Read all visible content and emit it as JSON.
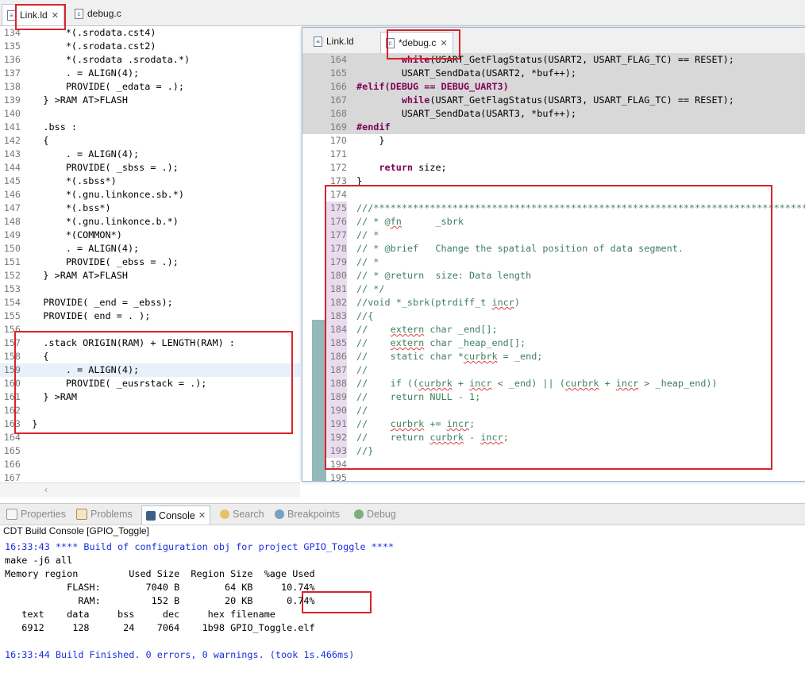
{
  "main_editor": {
    "tabs": [
      {
        "label": "Link.ld",
        "icon": "linker-file-icon",
        "active": true
      },
      {
        "label": "debug.c",
        "icon": "c-file-icon",
        "active": false
      }
    ],
    "lines": [
      {
        "n": "134",
        "t": "      *(.srodata.cst4)"
      },
      {
        "n": "135",
        "t": "      *(.srodata.cst2)"
      },
      {
        "n": "136",
        "t": "      *(.srodata .srodata.*)"
      },
      {
        "n": "137",
        "t": "      . = ALIGN(4);"
      },
      {
        "n": "138",
        "t": "      PROVIDE( _edata = .);"
      },
      {
        "n": "139",
        "t": "  } >RAM AT>FLASH"
      },
      {
        "n": "140",
        "t": ""
      },
      {
        "n": "141",
        "t": "  .bss :"
      },
      {
        "n": "142",
        "t": "  {"
      },
      {
        "n": "143",
        "t": "      . = ALIGN(4);"
      },
      {
        "n": "144",
        "t": "      PROVIDE( _sbss = .);"
      },
      {
        "n": "145",
        "t": "      *(.sbss*)"
      },
      {
        "n": "146",
        "t": "      *(.gnu.linkonce.sb.*)"
      },
      {
        "n": "147",
        "t": "      *(.bss*)"
      },
      {
        "n": "148",
        "t": "      *(.gnu.linkonce.b.*)"
      },
      {
        "n": "149",
        "t": "      *(COMMON*)"
      },
      {
        "n": "150",
        "t": "      . = ALIGN(4);"
      },
      {
        "n": "151",
        "t": "      PROVIDE( _ebss = .);"
      },
      {
        "n": "152",
        "t": "  } >RAM AT>FLASH"
      },
      {
        "n": "153",
        "t": ""
      },
      {
        "n": "154",
        "t": "  PROVIDE( _end = _ebss);"
      },
      {
        "n": "155",
        "t": "  PROVIDE( end = . );"
      },
      {
        "n": "156",
        "t": ""
      },
      {
        "n": "157",
        "t": "  .stack ORIGIN(RAM) + LENGTH(RAM) :"
      },
      {
        "n": "158",
        "t": "  {"
      },
      {
        "n": "159",
        "t": "      . = ALIGN(4);"
      },
      {
        "n": "160",
        "t": "      PROVIDE( _eusrstack = .);"
      },
      {
        "n": "161",
        "t": "  } >RAM"
      },
      {
        "n": "162",
        "t": ""
      },
      {
        "n": "163",
        "t": "}"
      },
      {
        "n": "164",
        "t": ""
      },
      {
        "n": "165",
        "t": ""
      },
      {
        "n": "166",
        "t": ""
      },
      {
        "n": "167",
        "t": ""
      }
    ]
  },
  "overlay_editor": {
    "tabs": [
      {
        "label": "Link.ld",
        "icon": "linker-file-icon",
        "active": false
      },
      {
        "label": "*debug.c",
        "icon": "c-file-icon",
        "active": true
      }
    ],
    "lines": [
      {
        "n": "164",
        "t": "        while(USART_GetFlagStatus(USART2, USART_FLAG_TC) == RESET);",
        "kind": "gray"
      },
      {
        "n": "165",
        "t": "        USART_SendData(USART2, *buf++);",
        "kind": "gray"
      },
      {
        "n": "166",
        "t": "#elif(DEBUG == DEBUG_UART3)",
        "kind": "gray"
      },
      {
        "n": "167",
        "t": "        while(USART_GetFlagStatus(USART3, USART_FLAG_TC) == RESET);",
        "kind": "gray"
      },
      {
        "n": "168",
        "t": "        USART_SendData(USART3, *buf++);",
        "kind": "gray"
      },
      {
        "n": "169",
        "t": "#endif",
        "kind": "gray"
      },
      {
        "n": "170",
        "t": "    }",
        "kind": "code"
      },
      {
        "n": "171",
        "t": "",
        "kind": "code"
      },
      {
        "n": "172",
        "t": "    return size;",
        "kind": "code"
      },
      {
        "n": "173",
        "t": "}",
        "kind": "code"
      },
      {
        "n": "174",
        "t": "",
        "kind": "code"
      },
      {
        "n": "175",
        "t": "///*****************************************************************************",
        "kind": "comment"
      },
      {
        "n": "176",
        "t": "// * @fn      _sbrk",
        "kind": "comment"
      },
      {
        "n": "177",
        "t": "// *",
        "kind": "comment"
      },
      {
        "n": "178",
        "t": "// * @brief   Change the spatial position of data segment.",
        "kind": "comment"
      },
      {
        "n": "179",
        "t": "// *",
        "kind": "comment"
      },
      {
        "n": "180",
        "t": "// * @return  size: Data length",
        "kind": "comment"
      },
      {
        "n": "181",
        "t": "// */",
        "kind": "comment"
      },
      {
        "n": "182",
        "t": "//void *_sbrk(ptrdiff_t incr)",
        "kind": "comment"
      },
      {
        "n": "183",
        "t": "//{",
        "kind": "comment"
      },
      {
        "n": "184",
        "t": "//    extern char _end[];",
        "kind": "comment"
      },
      {
        "n": "185",
        "t": "//    extern char _heap_end[];",
        "kind": "comment"
      },
      {
        "n": "186",
        "t": "//    static char *curbrk = _end;",
        "kind": "comment"
      },
      {
        "n": "187",
        "t": "//",
        "kind": "comment"
      },
      {
        "n": "188",
        "t": "//    if ((curbrk + incr < _end) || (curbrk + incr > _heap_end))",
        "kind": "comment"
      },
      {
        "n": "189",
        "t": "//    return NULL - 1;",
        "kind": "comment"
      },
      {
        "n": "190",
        "t": "//",
        "kind": "comment"
      },
      {
        "n": "191",
        "t": "//    curbrk += incr;",
        "kind": "comment"
      },
      {
        "n": "192",
        "t": "//    return curbrk - incr;",
        "kind": "comment"
      },
      {
        "n": "193",
        "t": "//}",
        "kind": "comment"
      },
      {
        "n": "194",
        "t": "",
        "kind": "code"
      },
      {
        "n": "195",
        "t": "",
        "kind": "code"
      }
    ]
  },
  "bottom_panel": {
    "tabs": [
      {
        "label": "Properties",
        "icon": "properties-icon",
        "active": false
      },
      {
        "label": "Problems",
        "icon": "problems-icon",
        "active": false
      },
      {
        "label": "Console",
        "icon": "console-icon",
        "active": true
      },
      {
        "label": "Search",
        "icon": "search-icon",
        "active": false
      },
      {
        "label": "Breakpoints",
        "icon": "breakpoints-icon",
        "active": false
      },
      {
        "label": "Debug",
        "icon": "debug-icon",
        "active": false
      }
    ],
    "console_title": "CDT Build Console [GPIO_Toggle]",
    "console_lines": [
      {
        "t": "16:33:43 **** Build of configuration obj for project GPIO_Toggle ****",
        "blue": true
      },
      {
        "t": "make -j6 all",
        "blue": false
      },
      {
        "t": "Memory region         Used Size  Region Size  %age Used",
        "blue": false
      },
      {
        "t": "           FLASH:        7040 B        64 KB     10.74%",
        "blue": false
      },
      {
        "t": "             RAM:         152 B        20 KB      0.74%",
        "blue": false
      },
      {
        "t": "   text    data     bss     dec     hex filename",
        "blue": false
      },
      {
        "t": "   6912     128      24    7064    1b98 GPIO_Toggle.elf",
        "blue": false
      },
      {
        "t": "",
        "blue": false
      },
      {
        "t": "16:33:44 Build Finished. 0 errors, 0 warnings. (took 1s.466ms)",
        "blue": true
      }
    ]
  },
  "colors": {
    "highlight_box": "#d9232d",
    "keyword": "#7f0055",
    "comment": "#3f7f5f",
    "console_info": "#1a2ee0"
  }
}
